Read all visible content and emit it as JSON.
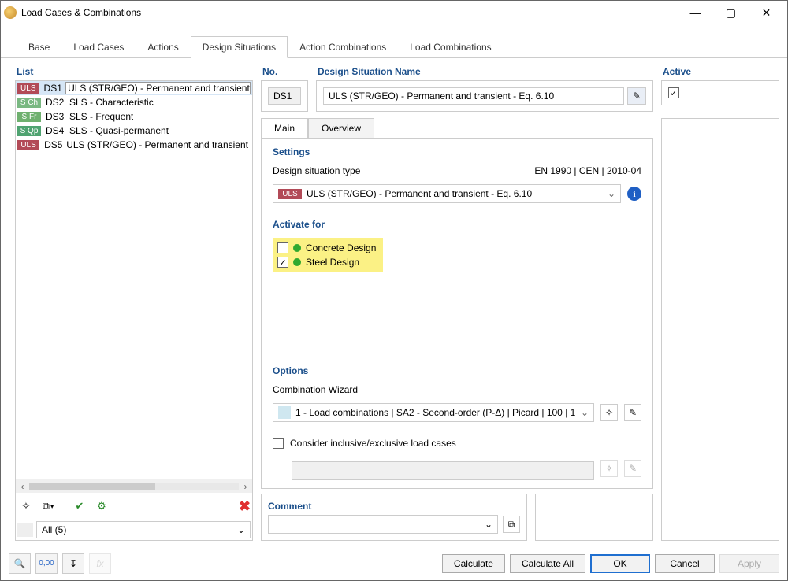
{
  "window": {
    "title": "Load Cases & Combinations"
  },
  "tabs": [
    "Base",
    "Load Cases",
    "Actions",
    "Design Situations",
    "Action Combinations",
    "Load Combinations"
  ],
  "active_tab_index": 3,
  "list": {
    "label": "List",
    "items": [
      {
        "badge": "ULS",
        "badge_class": "badge-uls",
        "num": "DS1",
        "name": "ULS (STR/GEO) - Permanent and transient - E",
        "selected": true
      },
      {
        "badge": "S Ch",
        "badge_class": "badge-sch",
        "num": "DS2",
        "name": "SLS - Characteristic",
        "selected": false
      },
      {
        "badge": "S Fr",
        "badge_class": "badge-sfr",
        "num": "DS3",
        "name": "SLS - Frequent",
        "selected": false
      },
      {
        "badge": "S Qp",
        "badge_class": "badge-sqp",
        "num": "DS4",
        "name": "SLS - Quasi-permanent",
        "selected": false
      },
      {
        "badge": "ULS",
        "badge_class": "badge-uls",
        "num": "DS5",
        "name": "ULS (STR/GEO) - Permanent and transient - E",
        "selected": false
      }
    ],
    "filter": "All (5)"
  },
  "header": {
    "no_label": "No.",
    "no_value": "DS1",
    "dsn_label": "Design Situation Name",
    "dsn_value": "ULS (STR/GEO) - Permanent and transient - Eq. 6.10",
    "active_label": "Active"
  },
  "subtabs": {
    "main": "Main",
    "overview": "Overview"
  },
  "settings": {
    "label": "Settings",
    "dstype_label": "Design situation type",
    "code": "EN 1990 | CEN | 2010-04",
    "dstype_badge": "ULS",
    "dstype_value": "ULS (STR/GEO) - Permanent and transient - Eq. 6.10"
  },
  "activate": {
    "label": "Activate for",
    "items": [
      {
        "label": "Concrete Design",
        "checked": false
      },
      {
        "label": "Steel Design",
        "checked": true
      }
    ]
  },
  "options": {
    "label": "Options",
    "cw_label": "Combination Wizard",
    "cw_value": "1 - Load combinations | SA2 - Second-order (P-Δ) | Picard | 100 | 1",
    "consider_label": "Consider inclusive/exclusive load cases"
  },
  "comment": {
    "label": "Comment"
  },
  "footer": {
    "calculate": "Calculate",
    "calculate_all": "Calculate All",
    "ok": "OK",
    "cancel": "Cancel",
    "apply": "Apply"
  }
}
